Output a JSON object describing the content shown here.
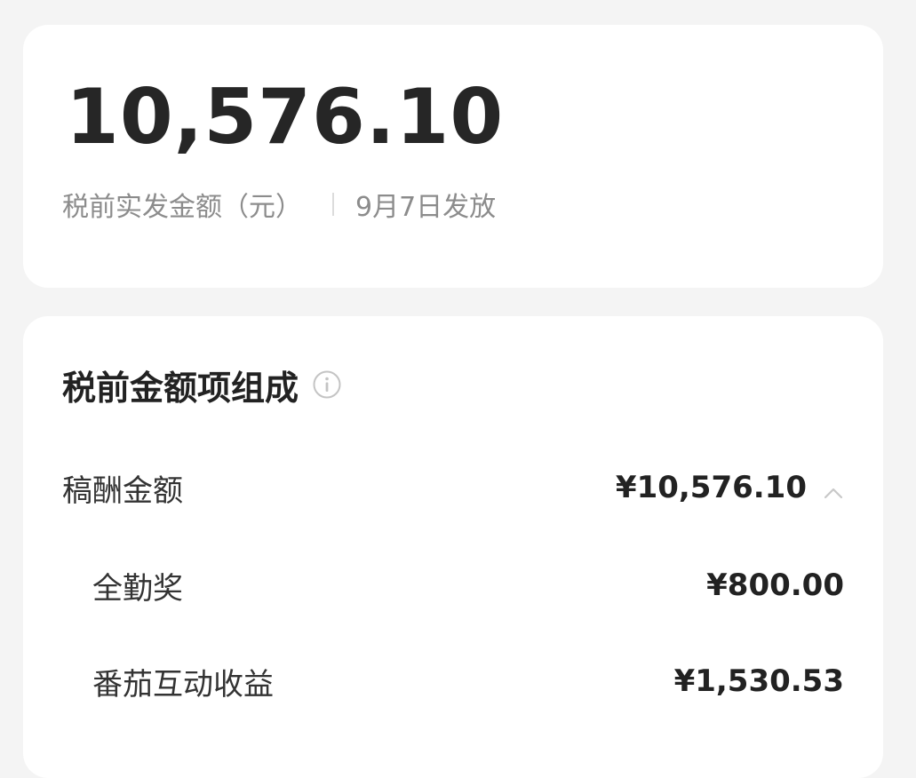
{
  "summary": {
    "amount": "10,576.10",
    "label": "税前实发金额（元）",
    "date": "9月7日发放"
  },
  "breakdown": {
    "title": "税前金额项组成",
    "info_icon": "info-circle-icon",
    "main_item": {
      "label": "稿酬金额",
      "value": "¥10,576.10",
      "expand_icon": "chevron-up-icon"
    },
    "sub_items": [
      {
        "label": "全勤奖",
        "value": "¥800.00"
      },
      {
        "label": "番茄互动收益",
        "value": "¥1,530.53"
      }
    ]
  }
}
